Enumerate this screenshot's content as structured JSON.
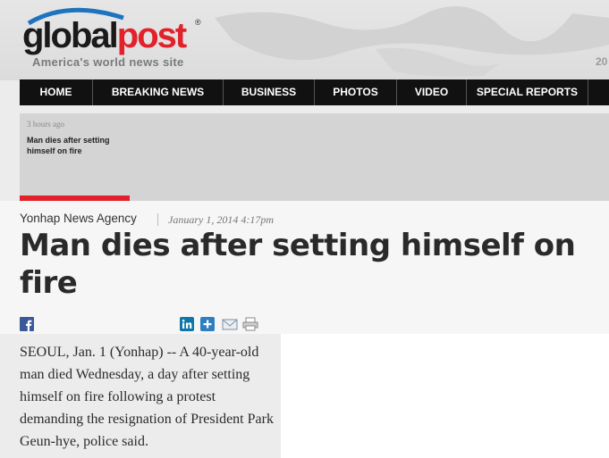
{
  "site": {
    "logo_part1": "global",
    "logo_part2": "post",
    "registered_mark": "®",
    "tagline": "America's world news site",
    "corner_text": "20"
  },
  "nav": {
    "items": [
      {
        "label": "HOME"
      },
      {
        "label": "BREAKING NEWS"
      },
      {
        "label": "BUSINESS"
      },
      {
        "label": "PHOTOS"
      },
      {
        "label": "VIDEO"
      },
      {
        "label": "SPECIAL REPORTS"
      },
      {
        "label": ""
      }
    ]
  },
  "ticker": {
    "time": "3 hours ago",
    "headline": "Man dies after setting himself on fire"
  },
  "article": {
    "source": "Yonhap News Agency",
    "date": "January 1, 2014 4:17pm",
    "title": "Man dies after setting himself on fire",
    "body": "SEOUL, Jan. 1 (Yonhap) -- A 40-year-old man died Wednesday, a day after setting himself on fire following a protest demanding the resignation of President Park Geun-hye, police said."
  },
  "share_icons": [
    "facebook-icon",
    "linkedin-icon",
    "add-icon",
    "email-icon",
    "print-icon"
  ],
  "colors": {
    "brand_red": "#e2212a",
    "nav_bg": "#111111",
    "facebook_blue": "#3b5998",
    "linkedin_blue": "#0e76a8"
  }
}
